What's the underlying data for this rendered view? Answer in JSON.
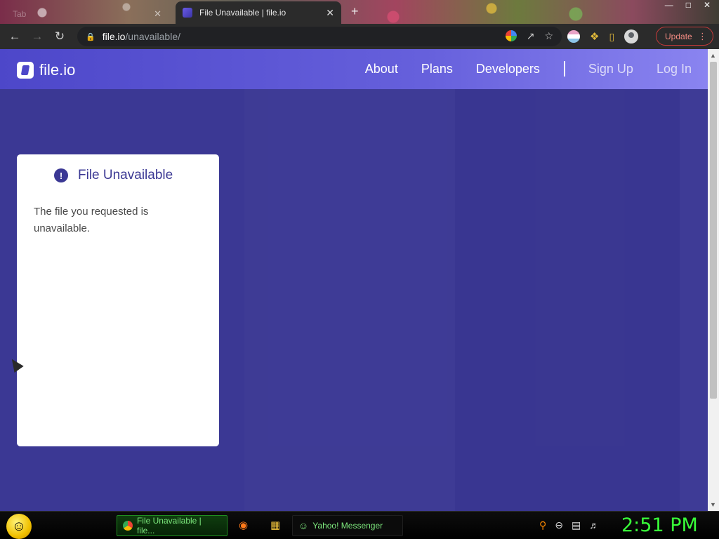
{
  "browser": {
    "inactive_tab_label": "Tab",
    "active_tab_title": "File Unavailable | file.io",
    "tab_close_glyph": "✕",
    "new_tab_glyph": "+",
    "url_host": "file.io",
    "url_path": "/unavailable/",
    "update_label": "Update"
  },
  "site": {
    "logo_text": "file.io",
    "nav": [
      {
        "label": "About"
      },
      {
        "label": "Plans"
      },
      {
        "label": "Developers"
      },
      {
        "label": "Sign Up"
      },
      {
        "label": "Log In"
      }
    ]
  },
  "card": {
    "icon_glyph": "!",
    "title": "File Unavailable",
    "message": "The file you requested is unavailable."
  },
  "taskbar": {
    "active_task_label": "File Unavailable | file...",
    "messenger_label": "Yahoo! Messenger",
    "clock": "2:51 PM"
  },
  "colors": {
    "page_background": "#3b3894",
    "header_gradient_start": "#4d47c9",
    "header_gradient_end": "#8a84f0",
    "card_title": "#3b3894",
    "update_border": "#c93a3a",
    "clock_green": "#39ff39"
  }
}
